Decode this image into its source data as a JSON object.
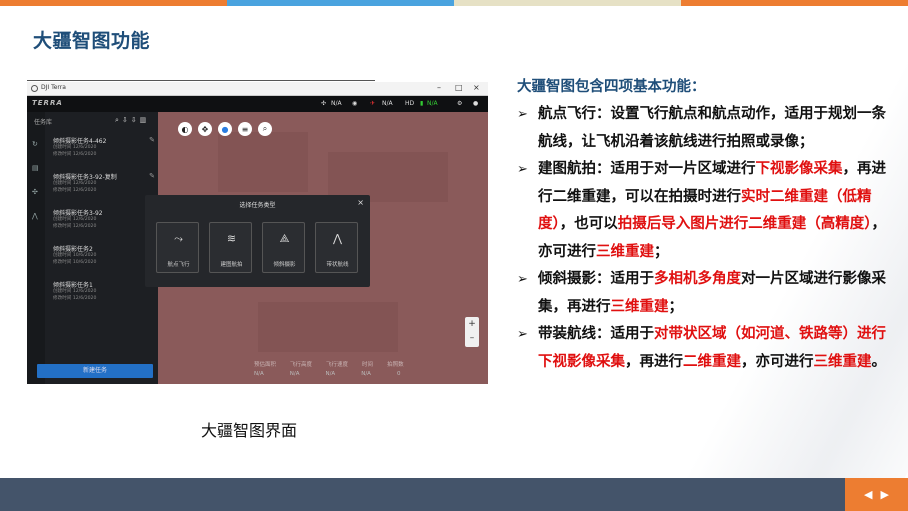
{
  "page": {
    "title": "大疆智图功能",
    "caption": "大疆智图界面",
    "top_bar_colors": [
      "#ed7d31",
      "#4aa3df",
      "#e6e1c5",
      "#ed7d31"
    ],
    "accent_title": "#1f4e79",
    "highlight_color": "#e01010"
  },
  "screenshot": {
    "window_title": "DJI Terra",
    "window_controls": [
      "–",
      "□",
      "×"
    ],
    "logo": "TERRA",
    "status": [
      "N/A",
      "N/A",
      "HD",
      "N/A"
    ],
    "sidebar_title": "任务库",
    "missions": [
      {
        "name": "倾斜摄影任务4-462",
        "created": "创建时间 12/6/2020",
        "modified": "修改时间 12/6/2020"
      },
      {
        "name": "倾斜摄影任务3-92-复制",
        "created": "创建时间 12/6/2020",
        "modified": "修改时间 12/6/2020"
      },
      {
        "name": "倾斜摄影任务3-92",
        "created": "创建时间 12/6/2020",
        "modified": "修改时间 12/6/2020"
      },
      {
        "name": "倾斜摄影任务2",
        "created": "创建时间 10/6/2020",
        "modified": "修改时间 10/6/2020"
      },
      {
        "name": "倾斜摄影任务1",
        "created": "创建时间 12/6/2020",
        "modified": "修改时间 12/6/2020"
      }
    ],
    "new_task_button": "新建任务",
    "dialog_title": "选择任务类型",
    "task_types": [
      "航点飞行",
      "建图航拍",
      "倾斜摄影",
      "带状航线"
    ],
    "stats_labels": [
      "预估面积",
      "飞行高度",
      "飞行速度",
      "时间",
      "拍照数"
    ],
    "stats_values": [
      "N/A",
      "N/A",
      "N/A",
      "N/A",
      "0"
    ]
  },
  "content": {
    "heading": "大疆智图包含四项基本功能：",
    "items": [
      {
        "parts": [
          {
            "t": "航点飞行：设置飞行航点和航点动作，适用于规划一条航线，让飞机沿着该航线进行拍照或录像；",
            "hl": false
          }
        ]
      },
      {
        "parts": [
          {
            "t": "建图航拍：适用于对一片区域进行",
            "hl": false
          },
          {
            "t": "下视影像采集",
            "hl": true
          },
          {
            "t": "，再进行二维重建，可以在拍摄时进行",
            "hl": false
          },
          {
            "t": "实时二维重建（低精度）",
            "hl": true
          },
          {
            "t": "，也可以",
            "hl": false
          },
          {
            "t": "拍摄后导入图片进行二维重建（高精度）",
            "hl": true
          },
          {
            "t": "，亦可进行",
            "hl": false
          },
          {
            "t": "三维重建",
            "hl": true
          },
          {
            "t": "；",
            "hl": false
          }
        ]
      },
      {
        "parts": [
          {
            "t": "倾斜摄影：适用于",
            "hl": false
          },
          {
            "t": "多相机多角度",
            "hl": true
          },
          {
            "t": "对一片区域进行影像采集，再进行",
            "hl": false
          },
          {
            "t": "三维重建",
            "hl": true
          },
          {
            "t": "；",
            "hl": false
          }
        ]
      },
      {
        "parts": [
          {
            "t": "带装航线：适用于",
            "hl": false
          },
          {
            "t": "对带状区域（如河道、铁路等）进行下视影像采集",
            "hl": true
          },
          {
            "t": "，再进行",
            "hl": false
          },
          {
            "t": "二维重建",
            "hl": true
          },
          {
            "t": "，亦可进行",
            "hl": false
          },
          {
            "t": "三维重建",
            "hl": true
          },
          {
            "t": "。",
            "hl": false
          }
        ]
      }
    ]
  },
  "nav": {
    "prev_icon": "triangle-left-icon",
    "next_icon": "triangle-right-icon"
  }
}
